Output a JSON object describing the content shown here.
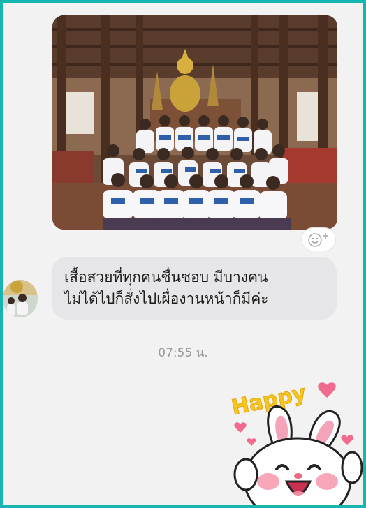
{
  "chat": {
    "messages": [
      {
        "type": "photo",
        "description_icon": "group-photo"
      },
      {
        "type": "text",
        "lines": [
          "เสื้อสวยที่ทุกคนชื่นชอบ มีบางคน",
          "ไม่ได้ไปก็สั่งไปเผื่องานหน้าก็มีค่ะ"
        ]
      }
    ],
    "timestamp": "07:55 น.",
    "sticker": {
      "text": "Happy",
      "icon": "happy-bunny-sticker"
    }
  },
  "colors": {
    "border": "#16b5b0",
    "background": "#f2f2f3",
    "bubble": "#e6e6e8",
    "sticker_yellow": "#f7c51e",
    "sticker_pink": "#f06b8f"
  }
}
